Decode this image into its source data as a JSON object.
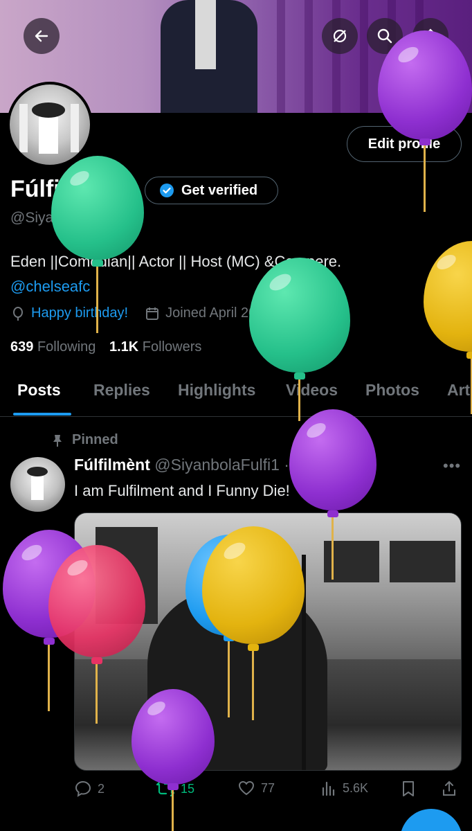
{
  "header": {
    "back_icon": "arrow-left-icon",
    "actions": [
      "sync-off-icon",
      "search-icon",
      "share-icon"
    ]
  },
  "profile": {
    "edit_label": "Edit profile",
    "name": "Fúlfilmènt",
    "verify_label": "Get verified",
    "handle": "@SiyanbolaFulfi1",
    "bio_line1": "Eden ||Comedian|| Actor || Host (MC) &Compere.",
    "bio_link": "@chelseafc",
    "birthday": "Happy birthday!",
    "joined": "Joined April 2020",
    "following_count": "639",
    "following_label": "Following",
    "followers_count": "1.1K",
    "followers_label": "Followers"
  },
  "tabs": [
    "Posts",
    "Replies",
    "Highlights",
    "Videos",
    "Photos",
    "Articles"
  ],
  "post": {
    "pinned_label": "Pinned",
    "author": "Fúlfilmènt",
    "handle_date": "@SiyanbolaFulfi1 · 10/06/2023",
    "text": "I am Fulfilment and I Funny Die!",
    "replies": "2",
    "reposts": "15",
    "likes": "77",
    "views": "5.6K"
  },
  "colors": {
    "accent": "#1d9bf0",
    "repost_green": "#00ba7c",
    "muted": "#71767b"
  },
  "balloons": [
    "purple",
    "green",
    "yellow",
    "purple",
    "pink",
    "blue"
  ]
}
